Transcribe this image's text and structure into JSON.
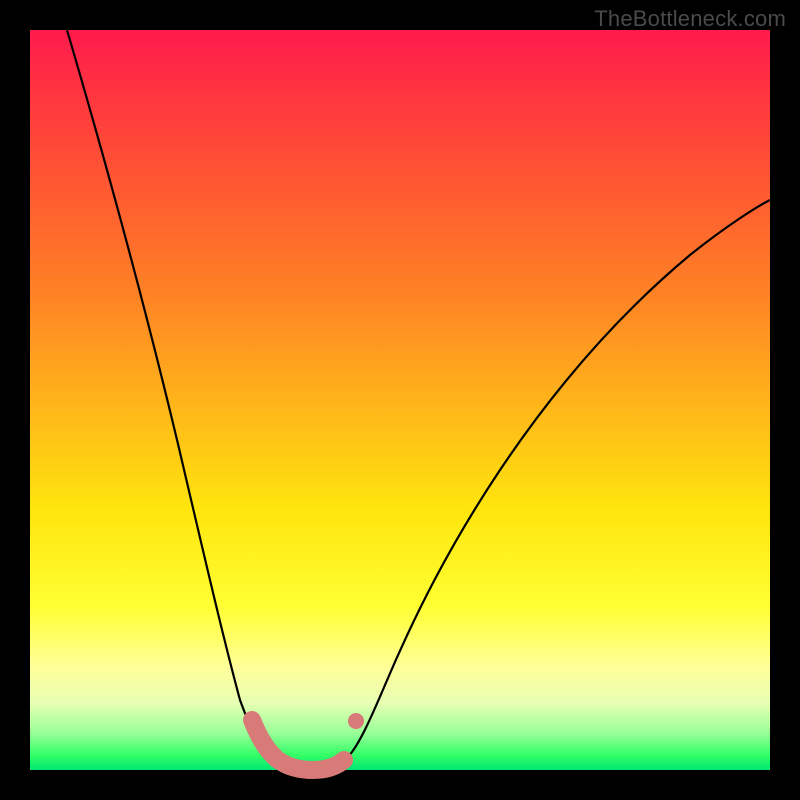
{
  "watermark": "TheBottleneck.com",
  "colors": {
    "frame": "#000000",
    "curve": "#000000",
    "marker": "#d87a78",
    "gradient_top": "#ff1a4d",
    "gradient_bottom": "#00e673"
  },
  "chart_data": {
    "type": "line",
    "title": "",
    "xlabel": "",
    "ylabel": "",
    "xlim": [
      0,
      1
    ],
    "ylim": [
      0,
      1
    ],
    "note": "Bottleneck-style V-curve. No axis ticks or numeric labels are rendered. x/y normalized to plot area (0=left/bottom, 1=right/top).",
    "series": [
      {
        "name": "bottleneck-curve",
        "x": [
          0.05,
          0.1,
          0.15,
          0.2,
          0.235,
          0.265,
          0.29,
          0.31,
          0.328,
          0.345,
          0.38,
          0.415,
          0.43,
          0.46,
          0.52,
          0.6,
          0.7,
          0.82,
          0.94,
          1.0
        ],
        "y": [
          1.0,
          0.83,
          0.65,
          0.44,
          0.28,
          0.17,
          0.095,
          0.05,
          0.022,
          0.008,
          0.0,
          0.0,
          0.01,
          0.055,
          0.17,
          0.33,
          0.49,
          0.63,
          0.74,
          0.79
        ]
      }
    ],
    "markers": {
      "name": "highlight-segment",
      "note": "Thick salmon worm along the valley plus one detached dot on the right wall.",
      "x": [
        0.3,
        0.318,
        0.335,
        0.352,
        0.372,
        0.392,
        0.412,
        0.424,
        0.438
      ],
      "y": [
        0.068,
        0.035,
        0.015,
        0.004,
        0.0,
        0.0,
        0.002,
        0.012,
        0.065
      ]
    }
  }
}
